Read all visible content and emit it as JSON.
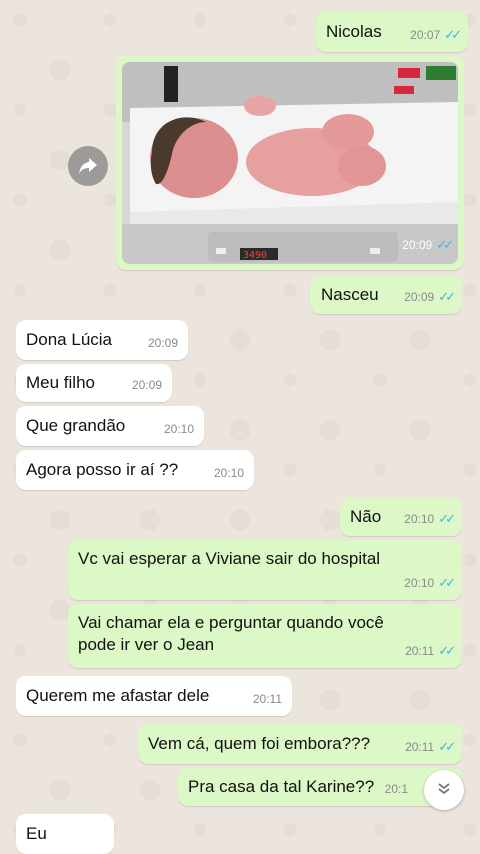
{
  "messages": [
    {
      "id": "m1",
      "dir": "out",
      "text": "Nicolas",
      "time": "20:07"
    },
    {
      "id": "m2",
      "dir": "out",
      "type": "photo",
      "time": "20:09",
      "scale_reading": "3490"
    },
    {
      "id": "m3",
      "dir": "out",
      "text": "Nasceu",
      "time": "20:09"
    },
    {
      "id": "m4",
      "dir": "in",
      "text": "Dona Lúcia",
      "time": "20:09"
    },
    {
      "id": "m5",
      "dir": "in",
      "text": "Meu filho",
      "time": "20:09"
    },
    {
      "id": "m6",
      "dir": "in",
      "text": "Que grandão",
      "time": "20:10"
    },
    {
      "id": "m7",
      "dir": "in",
      "text": "Agora posso ir aí ??",
      "time": "20:10"
    },
    {
      "id": "m8",
      "dir": "out",
      "text": "Não",
      "time": "20:10"
    },
    {
      "id": "m9",
      "dir": "out",
      "text": "Vc vai esperar a Viviane sair do hospital",
      "time": "20:10"
    },
    {
      "id": "m10",
      "dir": "out",
      "text": "Vai chamar ela e perguntar quando você pode ir ver o Jean",
      "time": "20:11"
    },
    {
      "id": "m11",
      "dir": "in",
      "text": "Querem me afastar dele",
      "time": "20:11"
    },
    {
      "id": "m12",
      "dir": "out",
      "text": "Vem cá, quem foi embora???",
      "time": "20:11"
    },
    {
      "id": "m13",
      "dir": "out",
      "text": "Pra casa da tal Karine??",
      "time": "20:1"
    },
    {
      "id": "m14",
      "dir": "in",
      "text": "Eu",
      "time": ""
    }
  ],
  "icons": {
    "forward": "forward-icon",
    "scroll_down": "chevron-down-icon",
    "read": "double-check-icon"
  },
  "colors": {
    "outgoing": "#dcf8c6",
    "incoming": "#ffffff",
    "read_ticks": "#34b7f1",
    "background": "#ece5dd"
  }
}
